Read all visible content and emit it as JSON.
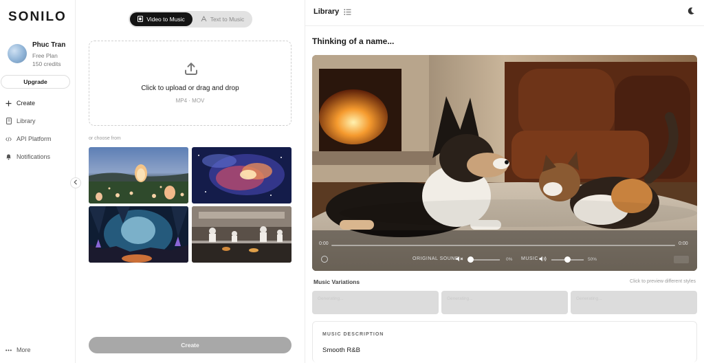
{
  "sidebar": {
    "logo": "SONILO",
    "user": {
      "name": "Phuc Tran",
      "plan": "Free Plan",
      "credits": "150 credits"
    },
    "upgrade_label": "Upgrade",
    "nav": [
      {
        "label": "Create",
        "icon": "plus-icon"
      },
      {
        "label": "Library",
        "icon": "book-icon"
      },
      {
        "label": "API Platform",
        "icon": "code-icon"
      },
      {
        "label": "Notifications",
        "icon": "bell-icon"
      }
    ],
    "more_label": "More"
  },
  "creator": {
    "modes": [
      {
        "label": "Video to Music",
        "active": true
      },
      {
        "label": "Text to Music",
        "active": false
      }
    ],
    "upload": {
      "title": "Click to upload or drag and drop",
      "formats": "MP4 · MOV"
    },
    "choose_label": "or choose from",
    "samples": [
      {
        "name": "sky-lanterns"
      },
      {
        "name": "nebula"
      },
      {
        "name": "crystal-cave"
      },
      {
        "name": "kitchen"
      }
    ],
    "create_label": "Create"
  },
  "library": {
    "title": "Library",
    "track_title": "Thinking of a name...",
    "player": {
      "time_start": "0:00",
      "time_end": "0:00",
      "original_sound_label": "ORIGINAL SOUND",
      "original_sound_pct": "0%",
      "original_sound_level": 0,
      "music_label": "MUSIC",
      "music_pct": "50%",
      "music_level": 50
    },
    "variations_title": "Music Variations",
    "variations_hint": "Click to preview different styles",
    "variations": [
      "Generating...",
      "Generating...",
      "Generating..."
    ],
    "description_label": "MUSIC DESCRIPTION",
    "description_value": "Smooth R&B"
  }
}
